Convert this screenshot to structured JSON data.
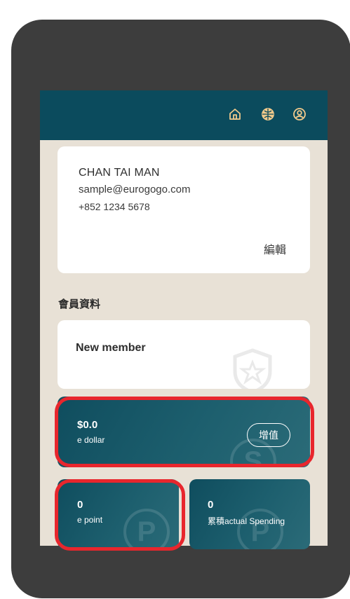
{
  "topbar": {
    "icons": [
      "home-icon",
      "globe-icon",
      "user-icon"
    ],
    "icon_color": "#f0c98b",
    "background": "#0b4b5d"
  },
  "profile": {
    "name": "CHAN TAI MAN",
    "email": "sample@eurogogo.com",
    "phone": "+852 1234 5678",
    "edit_label": "編輯"
  },
  "member_section": {
    "title": "會員資料",
    "tier": "New member"
  },
  "wallet": {
    "e_dollar_value": "$0.0",
    "e_dollar_label": "e dollar",
    "topup_label": "增值",
    "e_point_value": "0",
    "e_point_label": "e point",
    "spending_value": "0",
    "spending_label": "累積actual Spending"
  },
  "highlight_color": "#e8262d"
}
